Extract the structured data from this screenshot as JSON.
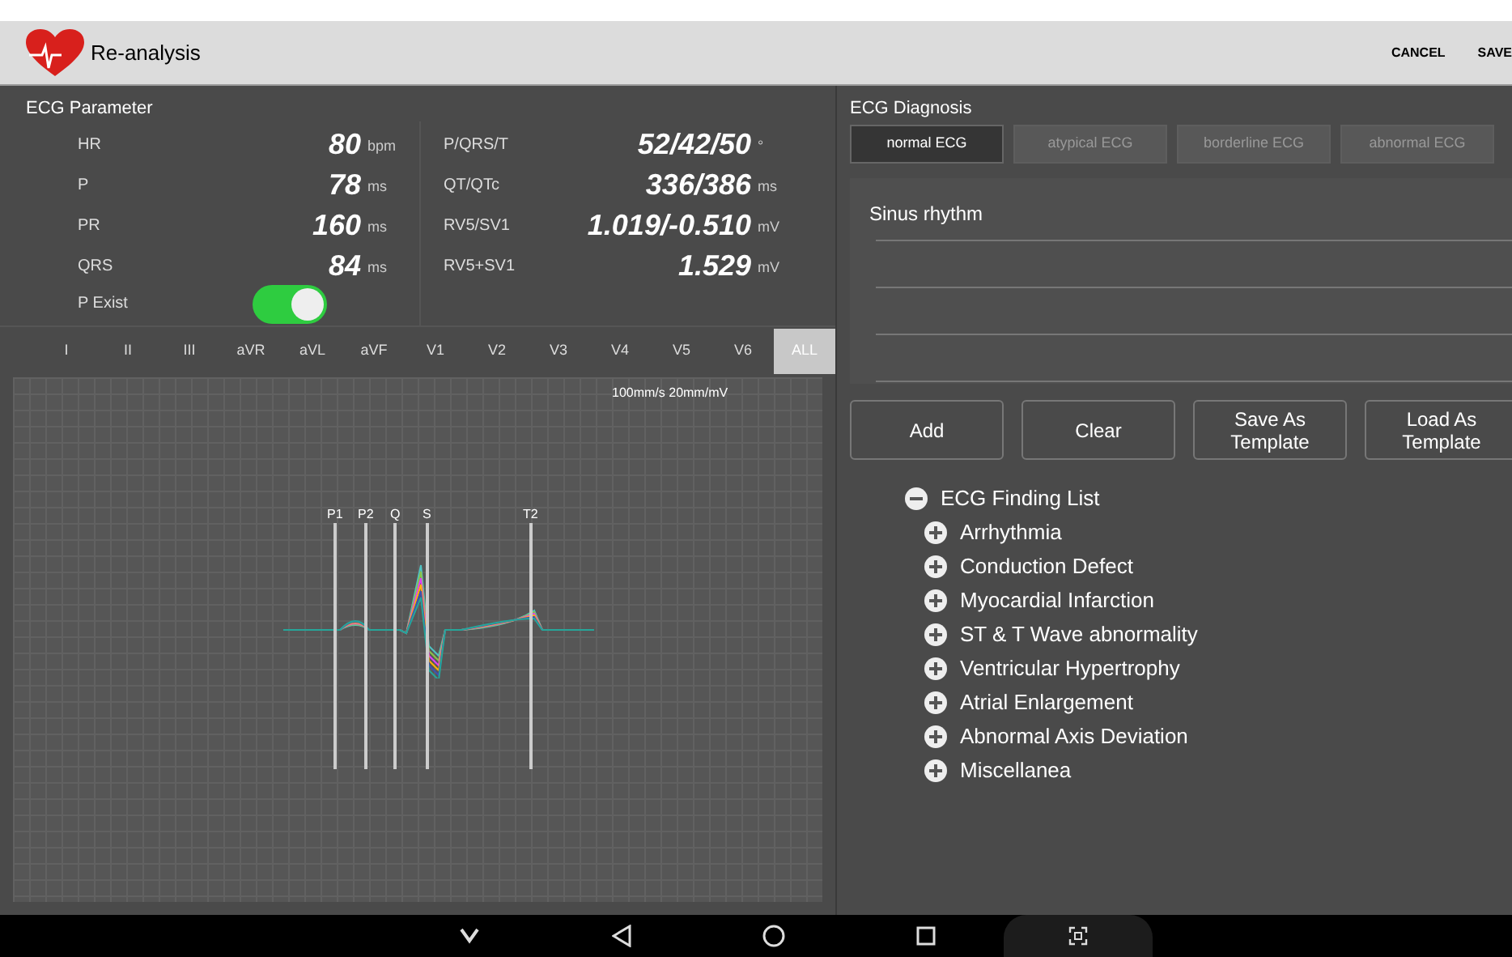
{
  "app_bar": {
    "title": "Re-analysis",
    "actions": [
      "CANCEL",
      "SAVE"
    ]
  },
  "parameters": {
    "title": "ECG Parameter",
    "left": [
      {
        "label": "HR",
        "value": "80",
        "unit": "bpm"
      },
      {
        "label": "P",
        "value": "78",
        "unit": "ms"
      },
      {
        "label": "PR",
        "value": "160",
        "unit": "ms"
      },
      {
        "label": "QRS",
        "value": "84",
        "unit": "ms"
      }
    ],
    "right": [
      {
        "label": "P/QRS/T",
        "value": "52/42/50",
        "unit": "°"
      },
      {
        "label": "QT/QTc",
        "value": "336/386",
        "unit": "ms"
      },
      {
        "label": "RV5/SV1",
        "value": "1.019/-0.510",
        "unit": "mV"
      },
      {
        "label": "RV5+SV1",
        "value": "1.529",
        "unit": "mV"
      }
    ],
    "p_exist": {
      "label": "P Exist",
      "on": true
    }
  },
  "leads": [
    {
      "label": "I",
      "selected": false
    },
    {
      "label": "II",
      "selected": false
    },
    {
      "label": "III",
      "selected": false
    },
    {
      "label": "aVR",
      "selected": false
    },
    {
      "label": "aVL",
      "selected": false
    },
    {
      "label": "aVF",
      "selected": false
    },
    {
      "label": "V1",
      "selected": false
    },
    {
      "label": "V2",
      "selected": false
    },
    {
      "label": "V3",
      "selected": false
    },
    {
      "label": "V4",
      "selected": false
    },
    {
      "label": "V5",
      "selected": false
    },
    {
      "label": "V6",
      "selected": false
    },
    {
      "label": "ALL",
      "selected": true
    }
  ],
  "waveform": {
    "scale": "100mm/s 20mm/mV",
    "markers": [
      "P1",
      "P2",
      "Q",
      "S",
      "T2"
    ]
  },
  "diagnosis": {
    "title": "ECG Diagnosis",
    "tabs": [
      {
        "label": "normal ECG",
        "selected": true
      },
      {
        "label": "atypical ECG",
        "selected": false
      },
      {
        "label": "borderline ECG",
        "selected": false
      },
      {
        "label": "abnormal ECG",
        "selected": false
      }
    ],
    "lines": [
      "Sinus rhythm"
    ],
    "buttons": [
      "Add",
      "Clear",
      "Save As\nTemplate",
      "Load As\nTemplate"
    ],
    "finding_list": {
      "label": "ECG Finding List",
      "expanded": true,
      "children": [
        {
          "label": "Arrhythmia",
          "expanded": false
        },
        {
          "label": "Conduction Defect",
          "expanded": false
        },
        {
          "label": "Myocardial Infarction",
          "expanded": false
        },
        {
          "label": "ST & T Wave abnormality",
          "expanded": false
        },
        {
          "label": "Ventricular Hypertrophy",
          "expanded": false
        },
        {
          "label": "Atrial Enlargement",
          "expanded": false
        },
        {
          "label": "Abnormal Axis Deviation",
          "expanded": false
        },
        {
          "label": "Miscellanea",
          "expanded": false
        }
      ]
    }
  }
}
